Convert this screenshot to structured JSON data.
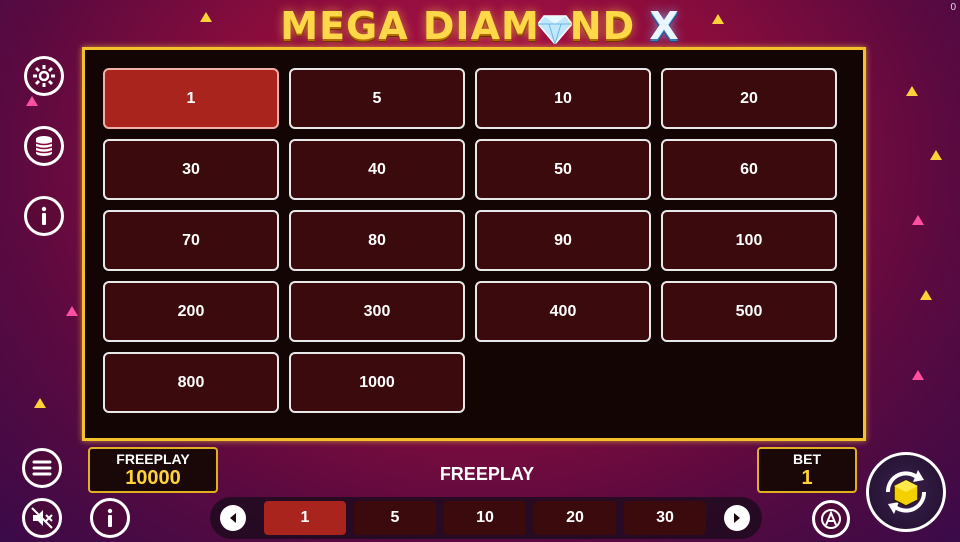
{
  "logo": {
    "text_a": "MEGA DIAM",
    "text_b": "ND",
    "text_x": "X"
  },
  "corner_counter": "0",
  "bet_options": [
    "1",
    "5",
    "10",
    "20",
    "30",
    "40",
    "50",
    "60",
    "70",
    "80",
    "90",
    "100",
    "200",
    "300",
    "400",
    "500",
    "800",
    "1000"
  ],
  "selected_bet": "1",
  "balance": {
    "label": "FREEPLAY",
    "value": "10000"
  },
  "status_text": "FREEPLAY",
  "bet": {
    "label": "BET",
    "value": "1"
  },
  "bet_selector": {
    "chips": [
      "1",
      "5",
      "10",
      "20",
      "30"
    ],
    "selected": "1"
  },
  "colors": {
    "accent_gold": "#f3c22b",
    "selected_red": "#a8241c",
    "value_yellow": "#ffd23a"
  },
  "icons": [
    "settings-gear-icon",
    "coins-stack-icon",
    "info-icon",
    "menu-hamburger-icon",
    "sound-muted-icon",
    "info-icon",
    "autoplay-icon",
    "spin-icon",
    "arrow-left-icon",
    "arrow-right-icon",
    "diamond-gem-icon"
  ]
}
